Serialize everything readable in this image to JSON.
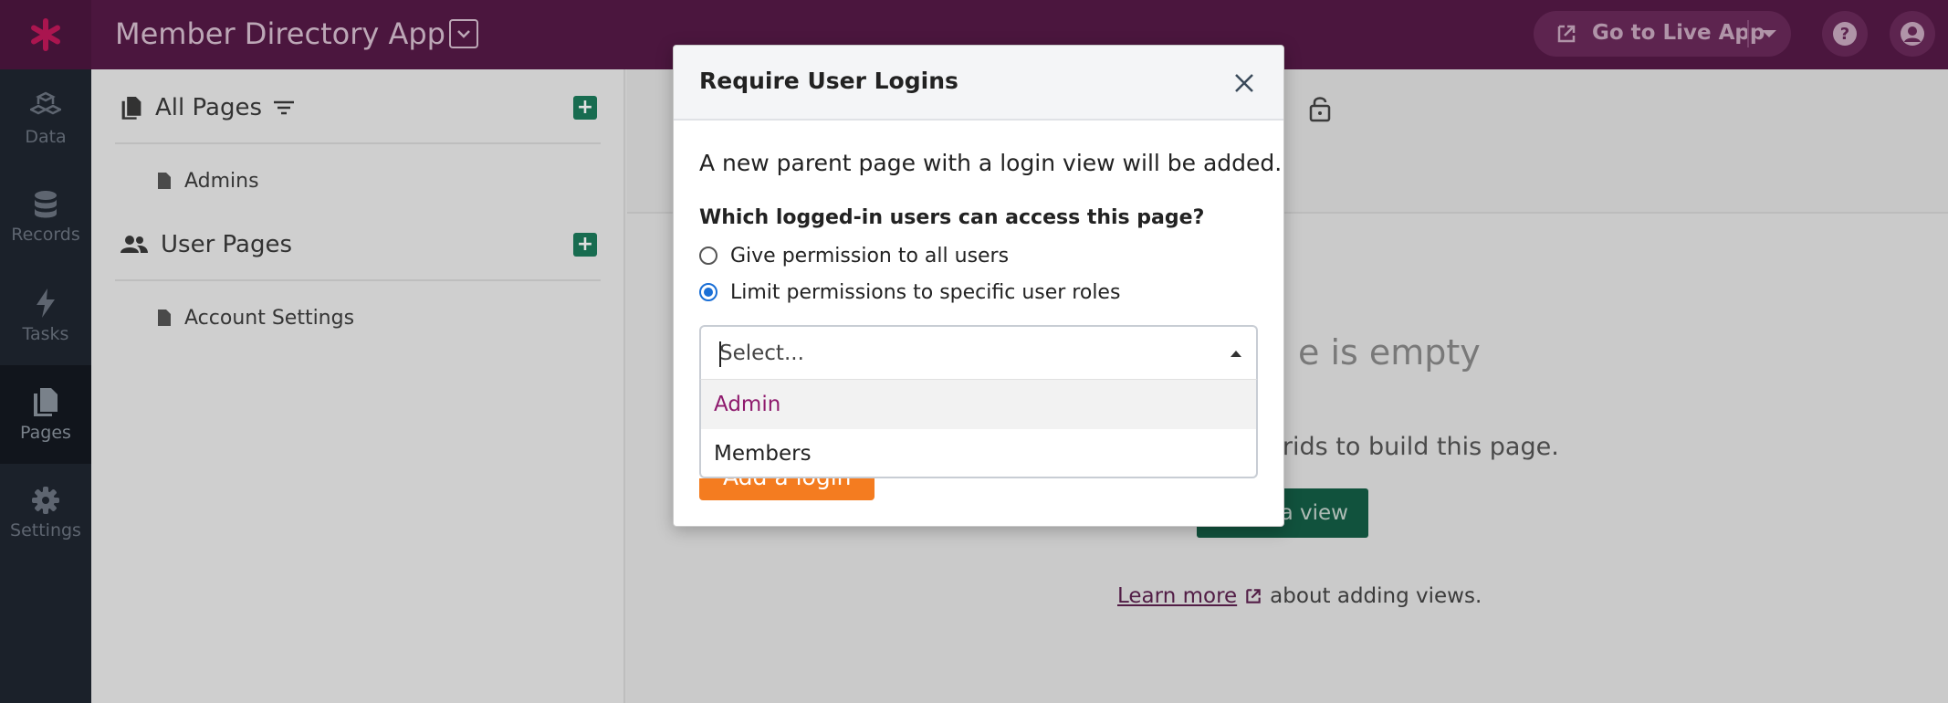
{
  "topbar": {
    "app_title": "Member Directory App",
    "live_app_label": "Go to Live App",
    "help_icon": "question-circle-icon",
    "account_icon": "user-circle-icon"
  },
  "leftnav": {
    "items": [
      {
        "label": "Data",
        "icon": "cubes-icon"
      },
      {
        "label": "Records",
        "icon": "database-icon"
      },
      {
        "label": "Tasks",
        "icon": "bolt-icon"
      },
      {
        "label": "Pages",
        "icon": "pages-icon",
        "active": true
      },
      {
        "label": "Settings",
        "icon": "gear-icon"
      }
    ]
  },
  "pages_panel": {
    "all_pages_title": "All Pages",
    "all_pages": [
      "Admins"
    ],
    "user_pages_title": "User Pages",
    "user_pages": [
      "Account Settings"
    ]
  },
  "main": {
    "empty_title": "e is empty",
    "empty_sub": "d grids to build this page.",
    "add_view_label": "a view",
    "learn_more": "Learn more",
    "learn_suffix": "about adding views."
  },
  "modal": {
    "title": "Require User Logins",
    "description": "A new parent page with a login view will be added.",
    "question": "Which logged-in users can access this page?",
    "options": [
      {
        "label": "Give permission to all users",
        "checked": false
      },
      {
        "label": "Limit permissions to specific user roles",
        "checked": true
      }
    ],
    "select_placeholder": "Select...",
    "dropdown_options": [
      "Admin",
      "Members"
    ],
    "highlighted_option": "Admin",
    "submit_label": "Add a login"
  },
  "colors": {
    "topbar": "#561a47",
    "leftnav": "#1f2630",
    "add_green": "#1c7c5c",
    "submit_orange": "#f47c20",
    "highlight_text": "#8e1a6d"
  }
}
